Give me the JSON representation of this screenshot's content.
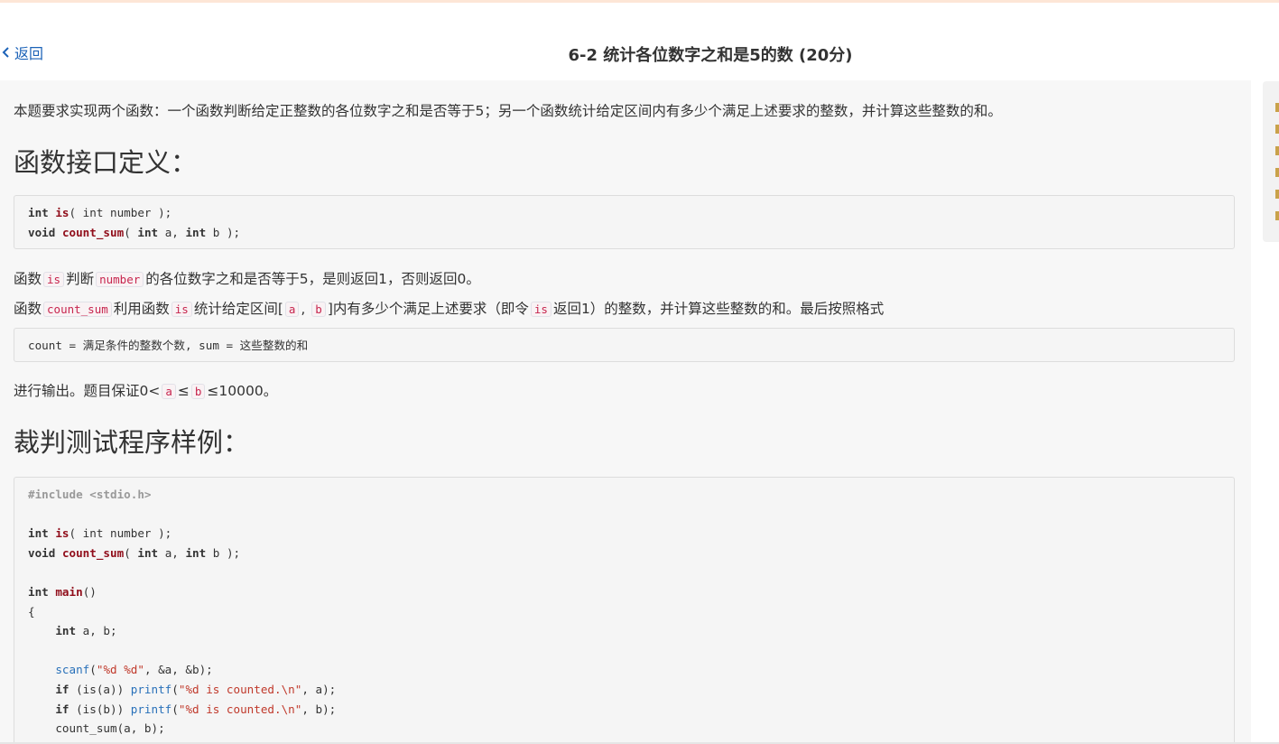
{
  "header": {
    "back_label": "返回",
    "title": "6-2 统计各位数字之和是5的数 (20分)"
  },
  "problem": {
    "intro": "本题要求实现两个函数：一个函数判断给定正整数的各位数字之和是否等于5；另一个函数统计给定区间内有多少个满足上述要求的整数，并计算这些整数的和。",
    "iface_heading": "函数接口定义：",
    "p1": {
      "t1": "函数",
      "c1": "is",
      "t2": "判断",
      "c2": "number",
      "t3": "的各位数字之和是否等于5，是则返回1，否则返回0。"
    },
    "p2": {
      "t1": "函数",
      "c1": "count_sum",
      "t2": "利用函数",
      "c2": "is",
      "t3": "统计给定区间[",
      "c3": "a",
      "t4": ", ",
      "c4": "b",
      "t5": "]内有多少个满足上述要求（即令",
      "c5": "is",
      "t6": "返回1）的整数，并计算这些整数的和。最后按照格式"
    },
    "format_line": "count = 满足条件的整数个数, sum = 这些整数的和",
    "p3": {
      "t1": "进行输出。题目保证0<",
      "c1": "a",
      "t2": "≤",
      "c2": "b",
      "t3": "≤10000。"
    },
    "test_heading": "裁判测试程序样例："
  },
  "code": {
    "kw_int": "int",
    "kw_void": "void",
    "kw_if": "if",
    "fn_is": "is",
    "fn_count_sum": "count_sum",
    "fn_main": "main",
    "include": "#include <stdio.h>",
    "is_args": "( int number );",
    "cs_args_open": "( ",
    "cs_args_int1": "int",
    "cs_args_a": " a, ",
    "cs_args_int2": "int",
    "cs_args_b": " b );",
    "main_parens": "()",
    "brace_open": "{",
    "decl_ab": " a, b;",
    "scanf": "scanf",
    "scanf_open": "(",
    "scanf_fmt": "\"%d %d\"",
    "scanf_rest": ", &a, &b);",
    "if_a_cond": " (is(a)) ",
    "if_b_cond": " (is(b)) ",
    "printf": "printf",
    "printf_open": "(",
    "printf_fmt": "\"%d is counted.\\n\"",
    "printf_rest_a": ", a);",
    "printf_rest_b": ", b);",
    "count_call": "count_sum(a, b);"
  }
}
